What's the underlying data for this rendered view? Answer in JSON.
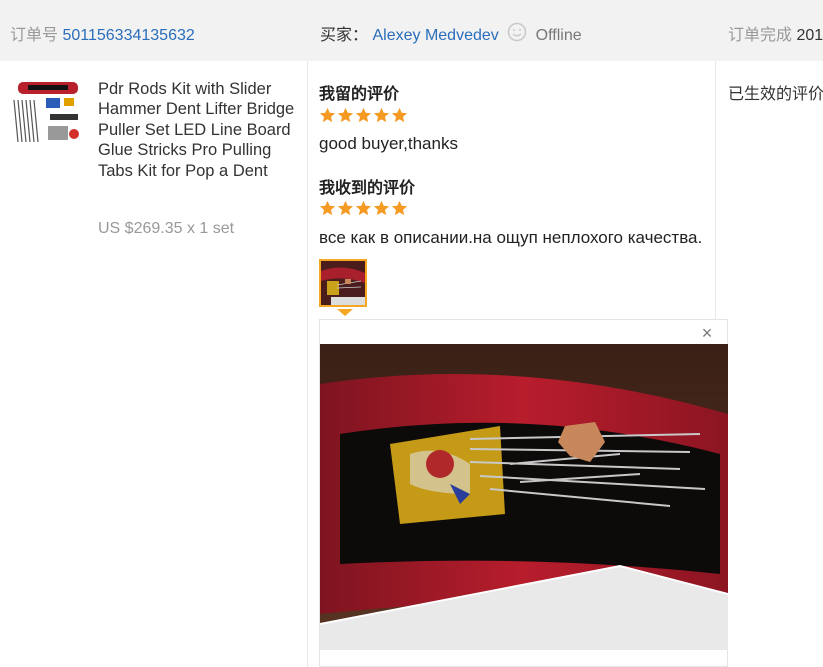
{
  "header": {
    "order_label": "订单号",
    "order_number": "501156334135632",
    "buyer_label": "买家：",
    "buyer_name": "Alexey Medvedev",
    "buyer_status": "Offline",
    "finish_label": "订单完成",
    "finish_value": "201"
  },
  "product": {
    "title": "Pdr Rods Kit with Slider Hammer Dent Lifter Bridge Puller Set LED Line Board Glue Stricks Pro Pulling Tabs Kit for Pop a Dent",
    "price": "US $269.35 x 1 set"
  },
  "my_review": {
    "label": "我留的评价",
    "rating": 5,
    "text": "good buyer,thanks"
  },
  "received_review": {
    "label": "我收到的评价",
    "rating": 5,
    "text": "все как в описании.на ощуп неплохого качества."
  },
  "preview": {
    "close_label": "×"
  },
  "status_column": {
    "text": "已生效的评价"
  },
  "colors": {
    "link": "#2a6ebb",
    "star": "#f59a23",
    "accent": "#f5a623"
  },
  "icons": {
    "smiley": "smiley-icon",
    "star": "star-icon",
    "close": "close-icon"
  }
}
